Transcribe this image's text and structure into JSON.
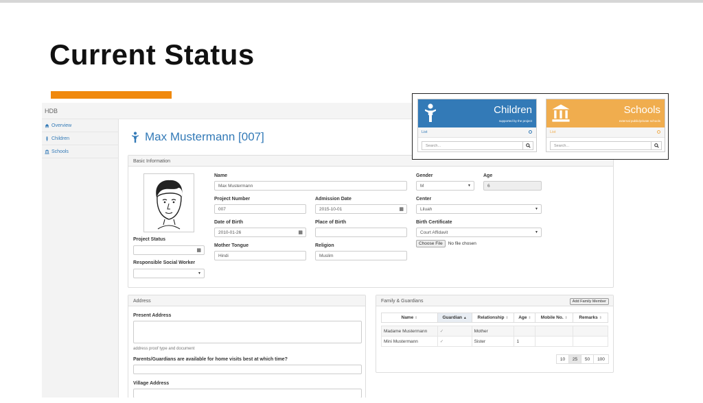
{
  "slide": {
    "title": "Current Status"
  },
  "app": {
    "brand": "HDB",
    "sidebar": [
      {
        "label": "Overview",
        "icon": "home-icon"
      },
      {
        "label": "Children",
        "icon": "child-icon"
      },
      {
        "label": "Schools",
        "icon": "school-icon"
      }
    ],
    "page_title": "Max Mustermann [007]"
  },
  "basic": {
    "header": "Basic Information",
    "name_label": "Name",
    "name_value": "Max Mustermann",
    "gender_label": "Gender",
    "gender_value": "M",
    "age_label": "Age",
    "age_value": "6",
    "project_number_label": "Project Number",
    "project_number_value": "007",
    "admission_date_label": "Admission Date",
    "admission_date_value": "2015-10-01",
    "center_label": "Center",
    "center_value": "Liluah",
    "dob_label": "Date of Birth",
    "dob_value": "2010-01-26",
    "pob_label": "Place of Birth",
    "pob_value": "",
    "birth_cert_label": "Birth Certificate",
    "birth_cert_value": "Court Affidavit",
    "choose_file": "Choose File",
    "no_file": "No file chosen",
    "mother_tongue_label": "Mother Tongue",
    "mother_tongue_value": "Hindi",
    "religion_label": "Religion",
    "religion_value": "Muslim",
    "project_status_label": "Project Status",
    "social_worker_label": "Responsible Social Worker"
  },
  "address": {
    "header": "Address",
    "present_label": "Present Address",
    "proof_hint": "address proof type and document",
    "visits_label": "Parents/Guardians are available for home visits best at which time?",
    "village_label": "Village Address"
  },
  "family": {
    "header": "Family & Guardians",
    "add_button": "Add Family Member",
    "columns": [
      "Name",
      "Guardian",
      "Relationship",
      "Age",
      "Mobile No.",
      "Remarks"
    ],
    "rows": [
      {
        "name": "Madame Mustermann",
        "guardian": "✓",
        "relationship": "Mother",
        "age": "",
        "mobile": "",
        "remarks": ""
      },
      {
        "name": "Mini Mustermann",
        "guardian": "✓",
        "relationship": "Sister",
        "age": "1",
        "mobile": "",
        "remarks": ""
      }
    ],
    "page_sizes": [
      "10",
      "25",
      "50",
      "100"
    ],
    "active_page_size": "25"
  },
  "cards": [
    {
      "title": "Children",
      "subtitle": "supported by the project",
      "list": "List",
      "search_placeholder": "Search...",
      "color": "#337ab7",
      "icon": "child-icon"
    },
    {
      "title": "Schools",
      "subtitle": "external public/private schools",
      "list": "List",
      "search_placeholder": "Search...",
      "color": "#f0ad4e",
      "icon": "school-icon"
    }
  ]
}
